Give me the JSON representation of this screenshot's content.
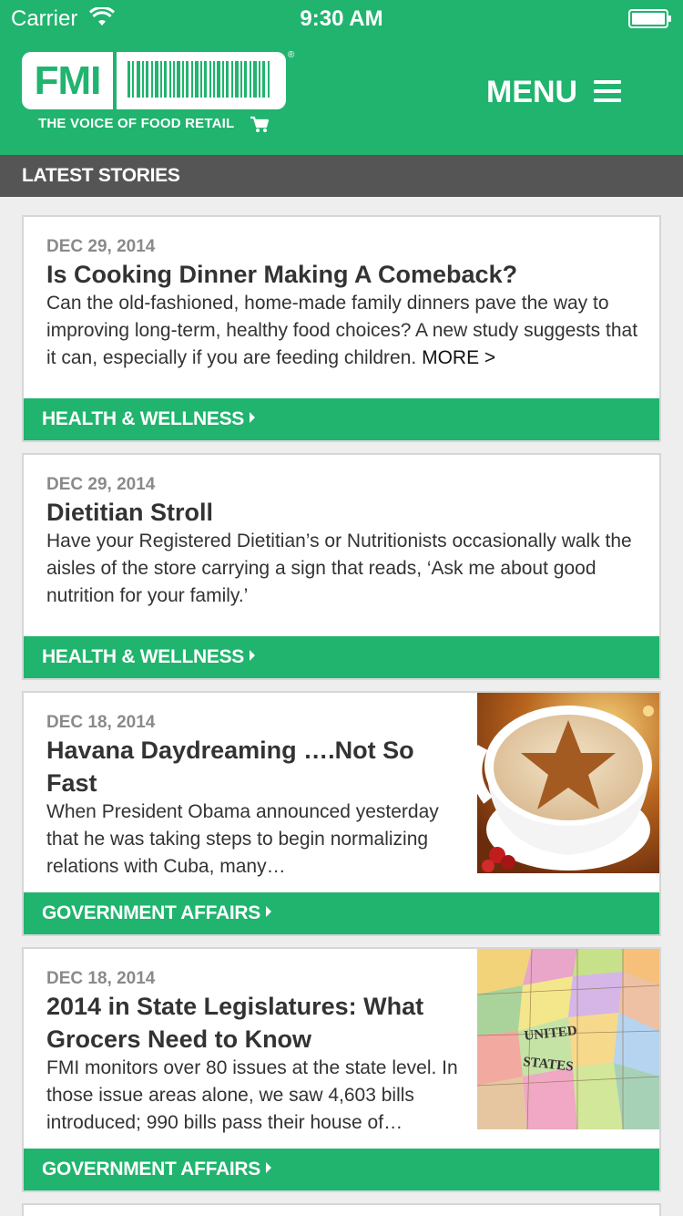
{
  "status_bar": {
    "carrier": "Carrier",
    "time": "9:30 AM"
  },
  "header": {
    "logo_text": "FMI",
    "tagline": "THE VOICE OF FOOD RETAIL",
    "registered_mark": "®",
    "menu_label": "MENU",
    "background_color": "#20b46e"
  },
  "section": {
    "title": "LATEST STORIES"
  },
  "stories": [
    {
      "date": "DEC 29, 2014",
      "title": "Is Cooking Dinner Making A Comeback?",
      "excerpt": "Can the old-fashioned, home-made family dinners pave the way to improving long-term, healthy food choices? A new study suggests that it can, especially if you are feeding children.",
      "more": "MORE >",
      "category": "HEALTH & WELLNESS"
    },
    {
      "date": "DEC 29, 2014",
      "title": "Dietitian Stroll",
      "excerpt": "Have your Registered Dietitian’s or Nutritionists occasionally walk the aisles of the store carrying a sign that reads, ‘Ask me about good nutrition for your family.’",
      "category": "HEALTH & WELLNESS"
    },
    {
      "date": "DEC 18, 2014",
      "title": "Havana Daydreaming ….Not So Fast",
      "excerpt": "When President Obama announced yesterday that he was taking steps to begin normalizing relations with Cuba, many…",
      "category": "GOVERNMENT AFFAIRS",
      "thumbnail": "coffee-cup-star-icon"
    },
    {
      "date": "DEC 18, 2014",
      "title": "2014 in State Legislatures: What Grocers Need to Know",
      "excerpt": "FMI monitors over 80 issues at the state level. In those issue areas alone, we saw 4,603 bills introduced; 990 bills pass their house of…",
      "category": "GOVERNMENT AFFAIRS",
      "thumbnail": "us-map-icon",
      "map_labels": {
        "united": "UNITED",
        "states": "STATES"
      }
    }
  ]
}
